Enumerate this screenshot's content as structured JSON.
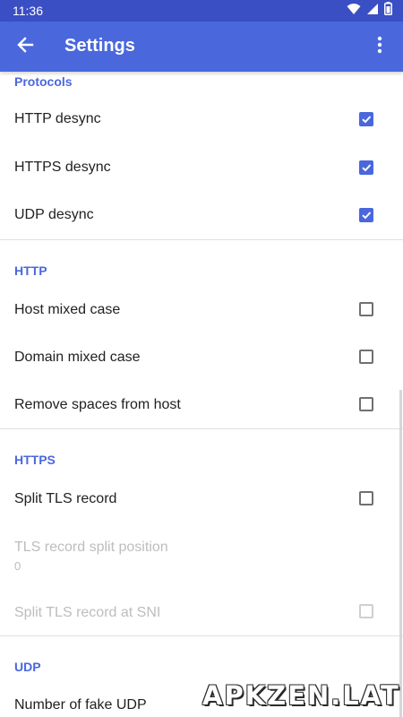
{
  "status_bar": {
    "time": "11:36",
    "icons": [
      "wifi-icon",
      "signal-icon",
      "battery-icon"
    ],
    "background": "#3a4fc4"
  },
  "app_bar": {
    "title": "Settings",
    "back_icon": "arrow-back-icon",
    "menu_icon": "more-vert-icon",
    "background": "#4a67dc"
  },
  "sections": [
    {
      "header": "Protocols",
      "items": [
        {
          "label": "HTTP desync",
          "checked": true
        },
        {
          "label": "HTTPS desync",
          "checked": true
        },
        {
          "label": "UDP desync",
          "checked": true
        }
      ]
    },
    {
      "header": "HTTP",
      "items": [
        {
          "label": "Host mixed case",
          "checked": false
        },
        {
          "label": "Domain mixed case",
          "checked": false
        },
        {
          "label": "Remove spaces from host",
          "checked": false
        }
      ]
    },
    {
      "header": "HTTPS",
      "items": [
        {
          "label": "Split TLS record",
          "checked": false
        },
        {
          "label": "TLS record split position",
          "value": "0",
          "enabled": false
        },
        {
          "label": "Split TLS record at SNI",
          "checked": false,
          "enabled": false
        }
      ]
    },
    {
      "header": "UDP",
      "items": [
        {
          "label": "Number of fake UDP"
        }
      ]
    }
  ],
  "watermark": "APKZEN.LAT",
  "accent_color": "#4a67dc"
}
